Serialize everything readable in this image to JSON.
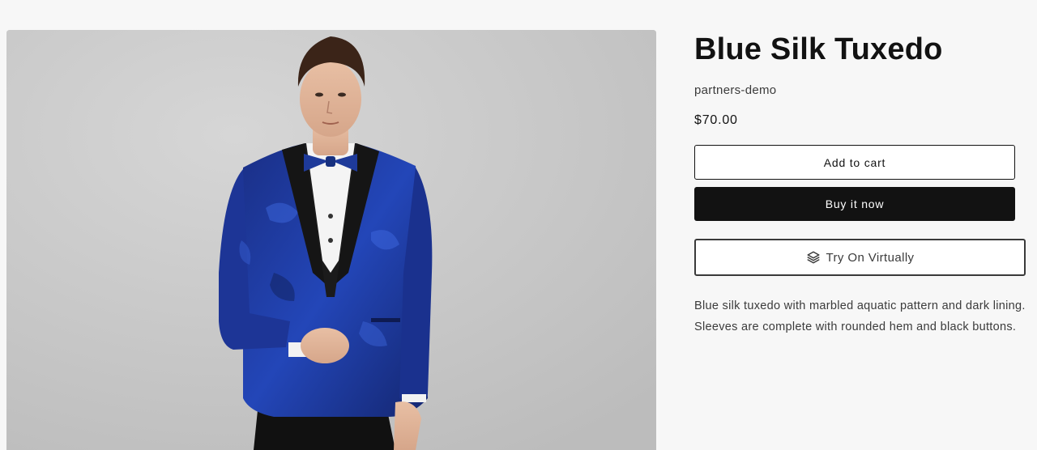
{
  "product": {
    "title": "Blue Silk Tuxedo",
    "vendor": "partners-demo",
    "price": "$70.00",
    "description": "Blue silk tuxedo with marbled aquatic pattern and dark lining. Sleeves are complete with rounded hem and black buttons.",
    "image_icon": "product-photo-man-in-blue-tuxedo"
  },
  "actions": {
    "add_to_cart": "Add to cart",
    "buy_now": "Buy it now",
    "try_on": "Try On Virtually",
    "try_on_icon": "layers-icon"
  },
  "colors": {
    "primary_button_bg": "#121212",
    "text": "#121212",
    "page_bg": "#f7f7f7",
    "jacket_blue": "#1f3fa3"
  }
}
